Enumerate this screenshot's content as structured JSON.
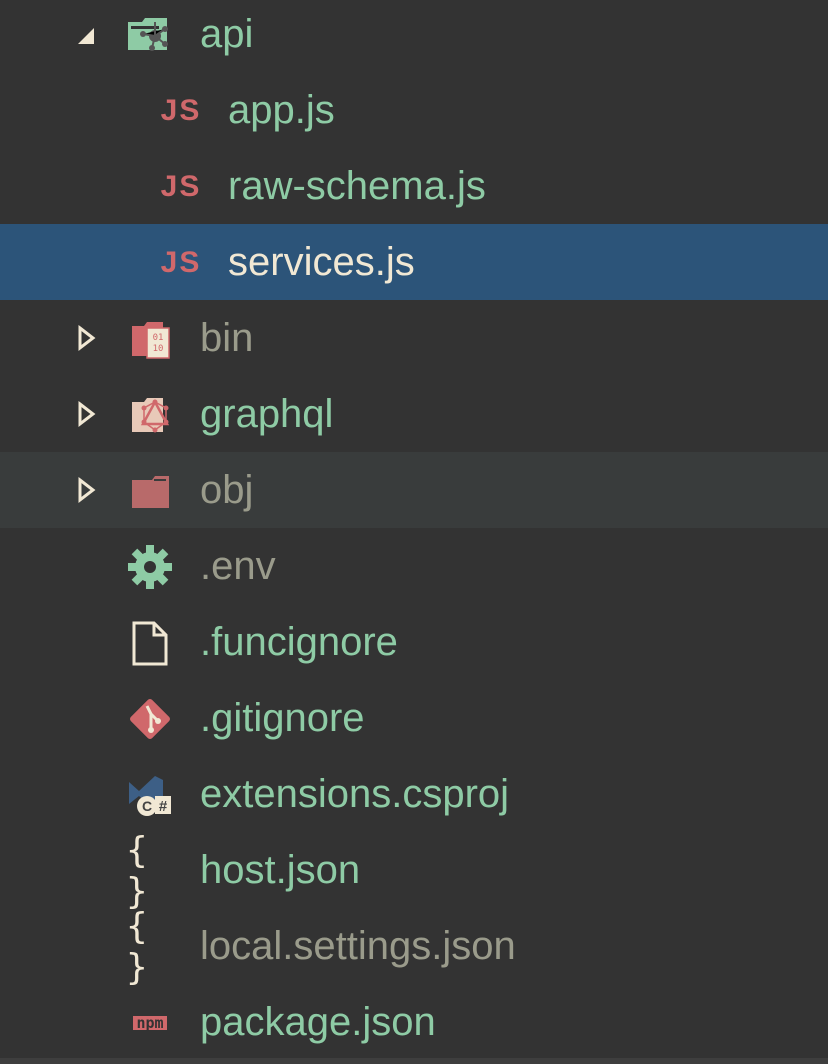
{
  "tree": [
    {
      "label": "api",
      "type": "folder",
      "expanded": true,
      "icon": "api-folder-icon"
    },
    {
      "label": "app.js",
      "type": "file",
      "icon": "js-icon",
      "icon_text": "JS"
    },
    {
      "label": "raw-schema.js",
      "type": "file",
      "icon": "js-icon",
      "icon_text": "JS"
    },
    {
      "label": "services.js",
      "type": "file",
      "icon": "js-icon",
      "icon_text": "JS",
      "selected": true
    },
    {
      "label": "bin",
      "type": "folder",
      "expanded": false,
      "icon": "binary-folder-icon",
      "ignored": true
    },
    {
      "label": "graphql",
      "type": "folder",
      "expanded": false,
      "icon": "graphql-folder-icon"
    },
    {
      "label": "obj",
      "type": "folder",
      "expanded": false,
      "icon": "folder-icon",
      "ignored": true,
      "hovered": true
    },
    {
      "label": ".env",
      "type": "file",
      "icon": "gear-icon",
      "ignored": true
    },
    {
      "label": ".funcignore",
      "type": "file",
      "icon": "file-icon"
    },
    {
      "label": ".gitignore",
      "type": "file",
      "icon": "git-icon"
    },
    {
      "label": "extensions.csproj",
      "type": "file",
      "icon": "csharp-project-icon"
    },
    {
      "label": "host.json",
      "type": "file",
      "icon": "json-icon",
      "icon_text": "{ }"
    },
    {
      "label": "local.settings.json",
      "type": "file",
      "icon": "json-icon",
      "icon_text": "{ }",
      "ignored": true
    },
    {
      "label": "package.json",
      "type": "file",
      "icon": "npm-icon",
      "icon_text": "npm"
    }
  ],
  "colors": {
    "background": "#333333",
    "selected": "#2c5479",
    "text": "#8ecba5",
    "ignored_text": "#9a9b8b",
    "selected_text": "#f1e8d4",
    "icon_red": "#d0686b"
  }
}
